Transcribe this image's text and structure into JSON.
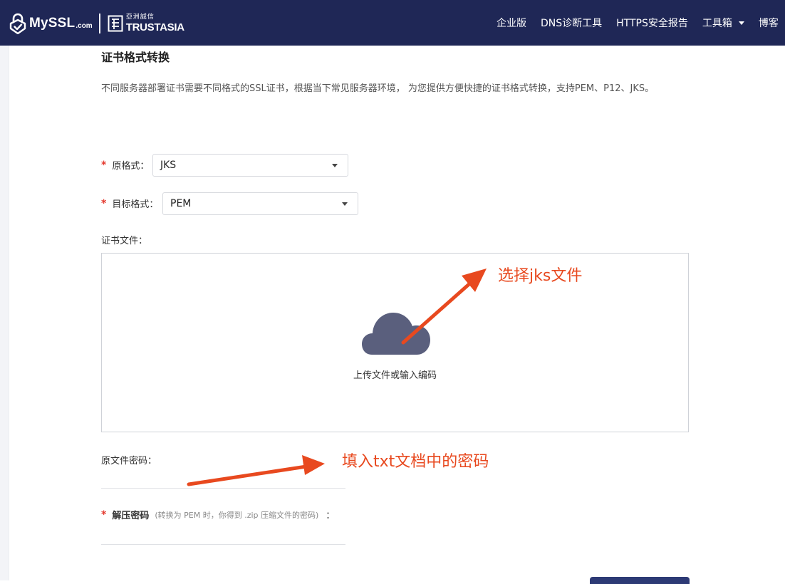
{
  "navbar": {
    "logo_text": "MySSL",
    "logo_suffix": ".com",
    "partner_cn": "亞洲誠信",
    "partner_en": "TRUSTASIA",
    "items": [
      {
        "label": "企业版"
      },
      {
        "label": "DNS诊断工具"
      },
      {
        "label": "HTTPS安全报告"
      },
      {
        "label": "工具箱",
        "dropdown": true
      },
      {
        "label": "博客"
      }
    ]
  },
  "page": {
    "title": "证书格式转换",
    "description": "不同服务器部署证书需要不同格式的SSL证书，根据当下常见服务器环境， 为您提供方便快捷的证书格式转换，支持PEM、P12、JKS。"
  },
  "form": {
    "required_mark": "*",
    "source_format": {
      "label": "原格式：",
      "value": "JKS"
    },
    "target_format": {
      "label": "目标格式：",
      "value": "PEM"
    },
    "cert_file": {
      "label": "证书文件：",
      "upload_text": "上传文件或输入编码"
    },
    "original_password": {
      "label": "原文件密码："
    },
    "unzip_password": {
      "label": "解压密码",
      "hint": "(转换为 PEM 时，你得到 .zip 压缩文件的密码)",
      "colon": "："
    }
  },
  "annotations": {
    "select_file": "选择jks文件",
    "fill_password": "填入txt文档中的密码"
  },
  "colors": {
    "navbar_bg": "#1f2756",
    "required": "#e4392e",
    "annotation": "#e8491f",
    "cloud": "#5a5f7d"
  }
}
